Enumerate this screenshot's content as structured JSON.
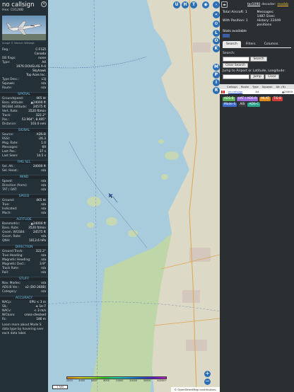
{
  "info": {
    "callsign": "no callsign",
    "hex_label": "Hex:",
    "hex": "C0128B",
    "close_glyph": "×",
    "photo_credit": "Image © Werner Wiesegt",
    "sections": {
      "spatial": "SPATIAL",
      "signal": "SIGNAL",
      "fms": "FMS SEL",
      "wind": "WIND",
      "speed": "SPEED",
      "altitude": "ALTITUDE",
      "direction": "DIRECTION",
      "stuff": "STUFF",
      "accuracy": "ACCURACY"
    },
    "details": [
      {
        "k": "Reg.:",
        "v": "C-FGZI"
      },
      {
        "k": "",
        "v": "Canada"
      },
      {
        "k": "DB flags:",
        "v": "none"
      },
      {
        "k": "Type:",
        "v": "A4"
      },
      {
        "k": "",
        "v": "1976 DOUGLAS A-4"
      },
      {
        "k": "",
        "v": "Skyhawk"
      },
      {
        "k": "",
        "v": "Top Aces Inc."
      },
      {
        "k": "Type Desc.:",
        "v": "L1J"
      },
      {
        "k": "Squawk:",
        "v": "n/a"
      },
      {
        "k": "Route:",
        "v": "n/a"
      }
    ],
    "spatial": [
      {
        "k": "Groundspeed:",
        "v": "465 kt"
      },
      {
        "k": "Baro. altitude:",
        "v": "▲24000 ft"
      },
      {
        "k": "WGS84 altitude:",
        "v": "24575 ft"
      },
      {
        "k": "Vert. Rate:",
        "v": "3520 ft/min"
      },
      {
        "k": "Track:",
        "v": "322.2°"
      },
      {
        "k": "Pos.:",
        "v": "53.964°, 8.495°"
      },
      {
        "k": "Distance:",
        "v": "103.0 nmi"
      }
    ],
    "signal": [
      {
        "k": "Source:",
        "v": "ADS-B"
      },
      {
        "k": "RSSI:",
        "v": "-26.3"
      },
      {
        "k": "Msg. Rate:",
        "v": "1.0"
      },
      {
        "k": "Messages:",
        "v": "69"
      },
      {
        "k": "Last Pos.:",
        "v": "37 s"
      },
      {
        "k": "Last Seen:",
        "v": "14.5 s"
      }
    ],
    "fms": [
      {
        "k": "Sel. Alt.:",
        "v": "24000 ft"
      },
      {
        "k": "Sel. Head.:",
        "v": "n/a"
      }
    ],
    "wind": [
      {
        "k": "Speed:",
        "v": "n/a"
      },
      {
        "k": "Direction (from):",
        "v": "n/a"
      },
      {
        "k": "TAT / OAT:",
        "v": "n/a"
      }
    ],
    "speed": [
      {
        "k": "Ground:",
        "v": "465 kt"
      },
      {
        "k": "True:",
        "v": "n/a"
      },
      {
        "k": "Indicated:",
        "v": "n/a"
      },
      {
        "k": "Mach:",
        "v": "n/a"
      }
    ],
    "altitude": [
      {
        "k": "Barometric:",
        "v": "▲24000 ft"
      },
      {
        "k": "Baro. Rate:",
        "v": "3520 ft/min"
      },
      {
        "k": "Geom. WGS84:",
        "v": "24575 ft"
      },
      {
        "k": "Geom. Rate:",
        "v": "n/a"
      },
      {
        "k": "QNH:",
        "v": "1013.6 hPa"
      }
    ],
    "direction": [
      {
        "k": "Ground Track:",
        "v": "322.2°"
      },
      {
        "k": "True Heading:",
        "v": "n/a"
      },
      {
        "k": "Magnetic Heading:",
        "v": "n/a"
      },
      {
        "k": "Magnetic Decl.:",
        "v": "3.9°"
      },
      {
        "k": "Track Rate:",
        "v": "n/a"
      },
      {
        "k": "Roll:",
        "v": "n/a"
      }
    ],
    "stuff": [
      {
        "k": "Nav. Modes:",
        "v": "n/a"
      },
      {
        "k": "ADS-B Ver.:",
        "v": "v2 (DO-260B)"
      },
      {
        "k": "Category:",
        "v": "n/a"
      }
    ],
    "accuracy": [
      {
        "k": "NACp:",
        "v": "EPU < 3 m"
      },
      {
        "k": "SIL:",
        "v": "≤ 1e-7"
      },
      {
        "k": "NACv:",
        "v": "< 3 m/s"
      },
      {
        "k": "NICbaro:",
        "v": "cross-checked"
      },
      {
        "k": "Rc:",
        "v": "186 m"
      }
    ],
    "footer": "Learn more about Mode S data type by hovering over each data label."
  },
  "map": {
    "top_buttons": [
      "U",
      "H",
      "T"
    ],
    "side_buttons": [
      "L",
      "O",
      "K",
      "M",
      "P",
      "I",
      "R"
    ],
    "zoom_in": "+",
    "zoom_out": "−",
    "scale": "1 NM",
    "attribution": "© OpenStreetMap contributors.",
    "legend_labels": [
      "2000",
      "4000",
      "6000",
      "8000",
      "10000",
      "20000",
      "30000",
      "40000+"
    ],
    "aircraft_track_deg": 322.2
  },
  "right": {
    "arrows_label": "◂▸",
    "brand_link": "tar1090",
    "brand_text": "decoder:",
    "brand_status": "readsb",
    "stats": {
      "total_label": "Total Aircraft: 1",
      "messages_label": "Messages: 1487.5/sec",
      "with_pos_label": "With Position: 1",
      "history_label": "History: 22449 positions"
    },
    "stats_link": "Stats available",
    "tabs": [
      "Search",
      "Filters",
      "Columns"
    ],
    "search_label": "Search:",
    "search_button": "Search",
    "clear_button": "Clear Search",
    "jump_label": "Jump to Airport or Latitude, Longitude:",
    "jump_button": "Jump",
    "clear2_button": "Clear",
    "table_headers": [
      "Callsign",
      "Route",
      "Type",
      "Squawk",
      "Alt. (ft)"
    ],
    "table_row": {
      "callsign": "no callsign",
      "type": "A4",
      "alt": "▲24000"
    },
    "source_tags": [
      {
        "label": "ADS-B",
        "color": "#5eb35e"
      },
      {
        "label": "UAT / ADS-R",
        "color": "#9a6ad8"
      },
      {
        "label": "MLAT",
        "color": "#e08a1a"
      },
      {
        "label": "TIS-B",
        "color": "#d23a3a"
      },
      {
        "label": "Mode-S",
        "color": "#3c6cc8"
      },
      {
        "label": "AIS",
        "color": "#3b3b3b"
      },
      {
        "label": "ADS-C",
        "color": "#2aa58c"
      }
    ]
  }
}
